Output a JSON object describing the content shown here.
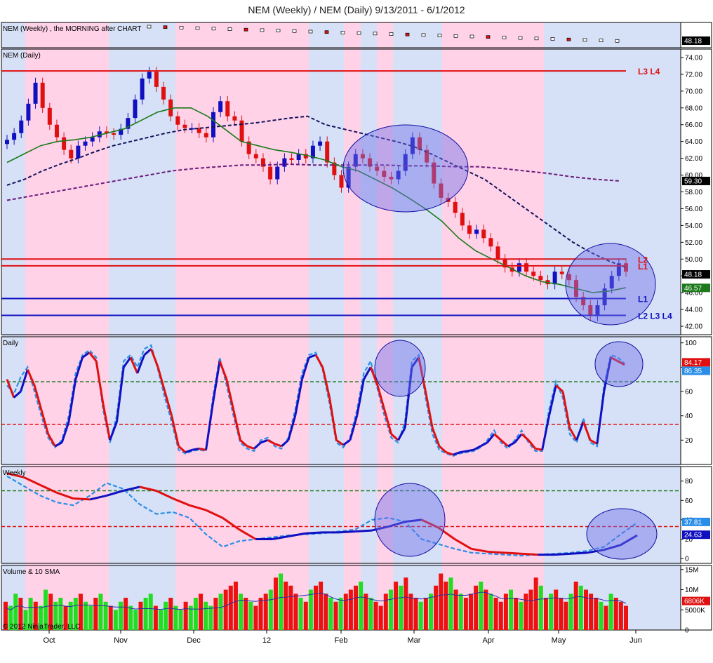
{
  "title": "NEM (Weekly) / NEM (Daily)  9/13/2011 - 6/1/2012",
  "chart_data": [
    {
      "pane": "weekly-strip",
      "type": "line",
      "series_label": "NEM (Weekly) , the MORNING after CHART",
      "last_value": "48.18"
    },
    {
      "pane": "price",
      "type": "candlestick",
      "title": "NEM (Daily)",
      "ylim": [
        41,
        75
      ],
      "yticks": [
        "74.00",
        "72.00",
        "70.00",
        "68.00",
        "66.00",
        "64.00",
        "62.00",
        "60.00",
        "58.00",
        "56.00",
        "54.00",
        "52.00",
        "50.00",
        "48.00",
        "46.00",
        "44.00",
        "42.00"
      ],
      "series": [
        {
          "name": "price",
          "values": [
            64.2,
            65.0,
            66.5,
            68.5,
            71.0,
            68.0,
            66.0,
            64.5,
            63.0,
            62.0,
            63.5,
            64.0,
            64.5,
            65.2,
            65.0,
            64.8,
            65.5,
            66.8,
            69.0,
            71.5,
            72.3,
            70.5,
            69.0,
            67.0,
            66.0,
            65.6,
            65.6,
            65.0,
            64.5,
            67.5,
            68.8,
            67.0,
            66.5,
            64.0,
            62.5,
            62.0,
            61.0,
            59.5,
            61.0,
            62.0,
            61.8,
            62.5,
            62.0,
            63.5,
            64.0,
            61.5,
            60.0,
            58.5,
            61.0,
            62.5,
            62.0,
            61.0,
            60.5,
            59.8,
            59.5,
            60.5,
            62.5,
            64.5,
            63.0,
            61.5,
            59.0,
            57.3,
            56.8,
            55.5,
            54.0,
            53.0,
            53.5,
            52.5,
            51.5,
            50.0,
            49.0,
            48.5,
            49.5,
            48.5,
            48.0,
            47.5,
            47.0,
            48.5,
            48.2,
            47.5,
            45.5,
            44.5,
            43.2,
            44.5,
            46.5,
            48.0,
            49.5,
            48.5
          ]
        },
        {
          "name": "sma-short",
          "values": [
            61.5,
            62.5,
            63.5,
            64.0,
            64.2,
            64.5,
            65.0,
            65.5,
            66.5,
            67.5,
            68.0,
            68.0,
            67.0,
            65.5,
            64.0,
            63.5,
            63.0,
            62.7,
            62.3,
            61.8,
            61.0,
            60.5,
            59.5,
            58.5,
            57.3,
            56.0,
            54.5,
            52.5,
            51.0,
            50.0,
            49.0,
            48.0,
            47.3,
            47.0,
            46.5,
            46.0,
            46.2,
            46.6
          ]
        },
        {
          "name": "sma-mid",
          "values": [
            58.8,
            59.5,
            60.5,
            61.3,
            62.0,
            62.8,
            63.5,
            64.0,
            64.5,
            65.0,
            65.4,
            65.6,
            65.8,
            66.0,
            66.2,
            66.5,
            66.8,
            67.0,
            66.0,
            65.5,
            65.0,
            64.5,
            64.0,
            63.4,
            62.5,
            61.5,
            60.5,
            59.5,
            58.0,
            56.5,
            55.0,
            53.5,
            52.0,
            50.8,
            49.8,
            49.0
          ]
        },
        {
          "name": "sma-long",
          "values": [
            57.0,
            57.5,
            58.0,
            58.5,
            59.0,
            59.5,
            60.0,
            60.5,
            60.8,
            61.0,
            61.2,
            61.2,
            61.3,
            61.2,
            61.2,
            61.2,
            61.2,
            61.1,
            61.1,
            61.0,
            61.0,
            60.8,
            60.5,
            60.2,
            59.8,
            59.5,
            59.3
          ]
        }
      ],
      "levels": [
        {
          "price": 72.4,
          "color": "#e01010",
          "label": "L3 L4"
        },
        {
          "price": 50.0,
          "color": "#e01010",
          "label": "L2"
        },
        {
          "price": 49.2,
          "color": "#e01010",
          "label": "L1"
        },
        {
          "price": 45.3,
          "color": "#1010c0",
          "label": "L1"
        },
        {
          "price": 43.3,
          "color": "#1010c0",
          "label": "L2 L3 L4"
        }
      ],
      "tags": [
        {
          "text": "59.30",
          "color": "#000000"
        },
        {
          "text": "48.18",
          "color": "#000000"
        },
        {
          "text": "46.57",
          "color": "#1c7a1c"
        }
      ]
    },
    {
      "pane": "daily-stochastic",
      "type": "line",
      "title": "Daily",
      "ylim": [
        0,
        105
      ],
      "yticks": [
        "100",
        "80",
        "60",
        "40",
        "20"
      ],
      "series": [
        {
          "name": "slow",
          "values": [
            70,
            55,
            60,
            78,
            65,
            45,
            25,
            15,
            18,
            35,
            70,
            88,
            92,
            85,
            50,
            20,
            35,
            80,
            88,
            75,
            90,
            95,
            80,
            60,
            40,
            15,
            10,
            12,
            13,
            12,
            50,
            85,
            70,
            45,
            20,
            15,
            13,
            18,
            20,
            17,
            15,
            20,
            40,
            70,
            88,
            90,
            80,
            55,
            20,
            16,
            20,
            40,
            70,
            80,
            65,
            45,
            25,
            20,
            30,
            80,
            88,
            60,
            30,
            15,
            10,
            8,
            10,
            11,
            12,
            15,
            18,
            25,
            20,
            15,
            18,
            25,
            20,
            13,
            12,
            40,
            65,
            60,
            30,
            20,
            35,
            20,
            17,
            60,
            88,
            85,
            82
          ]
        },
        {
          "name": "fast",
          "values": [
            65,
            58,
            72,
            80,
            60,
            40,
            22,
            14,
            20,
            40,
            75,
            90,
            94,
            88,
            45,
            18,
            40,
            85,
            90,
            80,
            95,
            98,
            78,
            55,
            35,
            12,
            9,
            11,
            12,
            11,
            55,
            88,
            65,
            40,
            18,
            13,
            11,
            20,
            22,
            15,
            13,
            22,
            45,
            75,
            90,
            92,
            78,
            50,
            18,
            14,
            22,
            45,
            75,
            85,
            62,
            40,
            22,
            18,
            35,
            85,
            90,
            55,
            25,
            12,
            9,
            7,
            9,
            10,
            11,
            14,
            20,
            28,
            18,
            13,
            20,
            28,
            18,
            11,
            11,
            45,
            68,
            55,
            25,
            18,
            38,
            18,
            15,
            65,
            90,
            88,
            83
          ]
        }
      ],
      "levels": [
        68,
        33
      ],
      "tags": [
        {
          "text": "84.17",
          "color": "#e01010"
        },
        {
          "text": "86.35",
          "color": "#2a8ee8"
        }
      ]
    },
    {
      "pane": "weekly-stochastic",
      "type": "line",
      "title": "Weekly",
      "ylim": [
        -5,
        95
      ],
      "yticks": [
        "80",
        "60",
        "40",
        "20",
        "0"
      ],
      "series": [
        {
          "name": "slow",
          "values": [
            88,
            84,
            76,
            68,
            62,
            61,
            65,
            70,
            74,
            70,
            62,
            55,
            50,
            42,
            30,
            20,
            20,
            23,
            26,
            27,
            27,
            28,
            29,
            33,
            38,
            40,
            32,
            20,
            10,
            7,
            6,
            5,
            4,
            4,
            5,
            6,
            9,
            14,
            24
          ]
        },
        {
          "name": "fast",
          "values": [
            85,
            75,
            65,
            58,
            55,
            65,
            78,
            72,
            56,
            46,
            48,
            42,
            25,
            12,
            18,
            20,
            22,
            24,
            25,
            26,
            28,
            30,
            40,
            42,
            38,
            20,
            15,
            10,
            6,
            5,
            4,
            3,
            4,
            5,
            6,
            8,
            12,
            25,
            37
          ]
        }
      ],
      "levels": [
        70,
        33
      ],
      "tags": [
        {
          "text": "37.81",
          "color": "#2a8ee8"
        },
        {
          "text": "24.63",
          "color": "#1010c0"
        }
      ]
    },
    {
      "pane": "volume",
      "type": "bar",
      "title": "Volume & 10 SMA",
      "ylim": [
        0,
        16
      ],
      "yticks": [
        "15M",
        "10M",
        "5000K",
        "0"
      ],
      "values": [
        7,
        6,
        9,
        8,
        5,
        8,
        7,
        6,
        10,
        9,
        7,
        8,
        6,
        7,
        8,
        9,
        7,
        6,
        8,
        9,
        7,
        6,
        5,
        7,
        8,
        6,
        5,
        7,
        8,
        9,
        6,
        5,
        7,
        8,
        6,
        5,
        7,
        6,
        8,
        9,
        7,
        6,
        8,
        9,
        10,
        11,
        12,
        9,
        8,
        7,
        6,
        8,
        9,
        10,
        13,
        14,
        12,
        11,
        9,
        8,
        7,
        10,
        11,
        12,
        9,
        8,
        7,
        8,
        9,
        10,
        11,
        12,
        9,
        8,
        7,
        6,
        9,
        10,
        12,
        11,
        13,
        9,
        8,
        7,
        8,
        9,
        11,
        14,
        12,
        13,
        10,
        9,
        8,
        9,
        11,
        12,
        10,
        9,
        8,
        7,
        9,
        10,
        8,
        7,
        9,
        10,
        13,
        11,
        8,
        9,
        10,
        8,
        7,
        9,
        12,
        11,
        10,
        9,
        8,
        7,
        6,
        9,
        8,
        7,
        6
      ],
      "last_tag": {
        "text": "6806K",
        "color": "#e01010"
      }
    }
  ],
  "xaxis_labels": [
    "Oct",
    "Nov",
    "Dec",
    "12",
    "Feb",
    "Mar",
    "Apr",
    "May",
    "Jun"
  ],
  "footer": "© 2012 NinjaTrader, LLC",
  "colors": {
    "band_pink": "#ffd2e8",
    "band_blue": "#d6e0f6",
    "up": "#1010c0",
    "down": "#e01010",
    "sma_green": "#1c7a1c",
    "circle_fill": "#7070e8",
    "circle_stroke": "#1010a0"
  }
}
